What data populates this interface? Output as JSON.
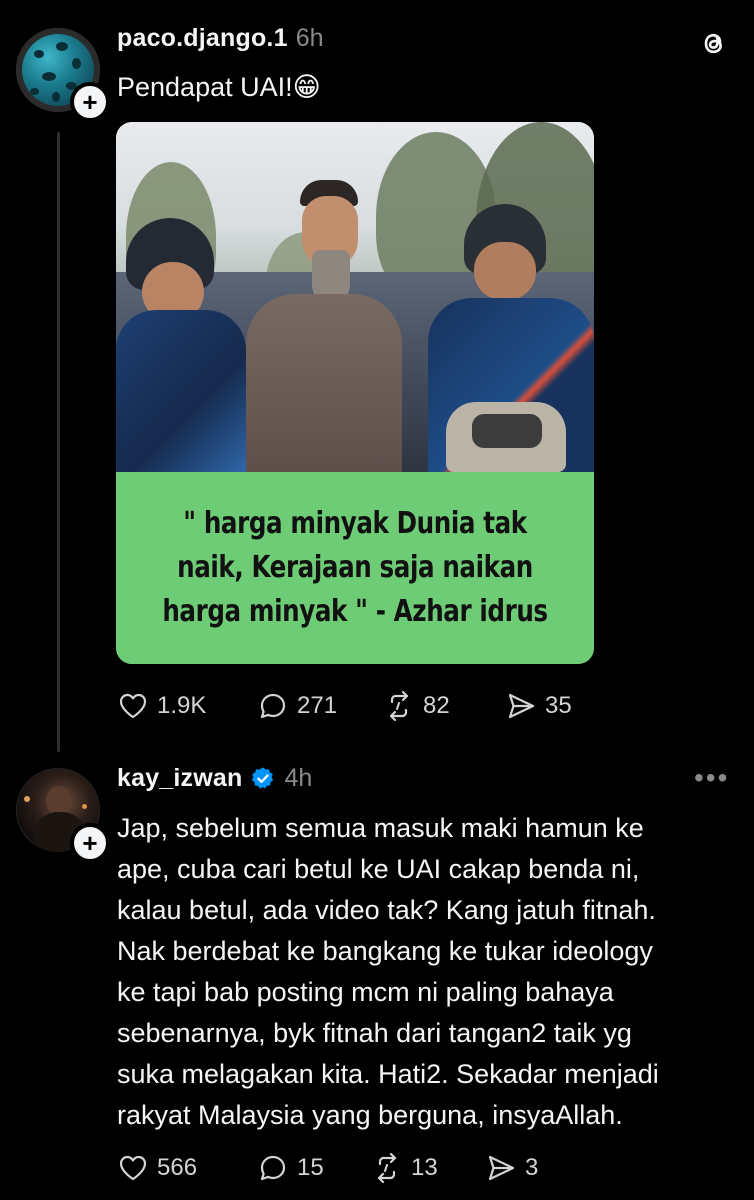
{
  "post": {
    "username": "paco.django.1",
    "time": "6h",
    "text": "Pendapat UAI!",
    "emoji": "😁",
    "image_caption": "\" harga minyak Dunia tak naik, Kerajaan saja naikan harga minyak \" - Azhar idrus",
    "likes": "1.9K",
    "replies": "271",
    "reposts": "82",
    "shares": "35"
  },
  "reply": {
    "username": "kay_izwan",
    "time": "4h",
    "text": "Jap, sebelum semua masuk maki hamun ke ape, cuba cari betul ke UAI cakap benda ni, kalau betul, ada video tak? Kang jatuh fitnah. Nak berdebat ke bangkang ke tukar ideology ke tapi bab posting mcm ni paling bahaya sebenarnya, byk fitnah dari tangan2 taik yg suka melagakan kita. Hati2. Sekadar menjadi rakyat Malaysia yang berguna, insyaAllah.",
    "lines": [
      "Jap, sebelum semua masuk maki hamun ke",
      "ape, cuba cari betul ke UAI cakap benda ni,",
      "kalau betul, ada video tak? Kang jatuh fitnah.",
      "Nak berdebat ke bangkang ke tukar ideology",
      "ke tapi bab posting mcm ni paling bahaya",
      "sebenarnya, byk fitnah dari tangan2 taik yg",
      "suka melagakan kita. Hati2. Sekadar menjadi",
      "rakyat Malaysia yang berguna, insyaAllah."
    ],
    "likes": "566",
    "replies": "15",
    "reposts": "13",
    "shares": "3"
  },
  "icons": {
    "app_logo": "threads-logo-icon",
    "follow": "plus-icon",
    "like": "heart-icon",
    "reply": "comment-icon",
    "repost": "repost-icon",
    "share": "send-icon",
    "verified": "verified-badge-icon",
    "more": "more-options-icon"
  },
  "colors": {
    "background": "#000000",
    "text": "#f3f5f7",
    "muted": "#8a8a8a",
    "caption_bg": "#6dcc75",
    "verified": "#0095f6"
  }
}
